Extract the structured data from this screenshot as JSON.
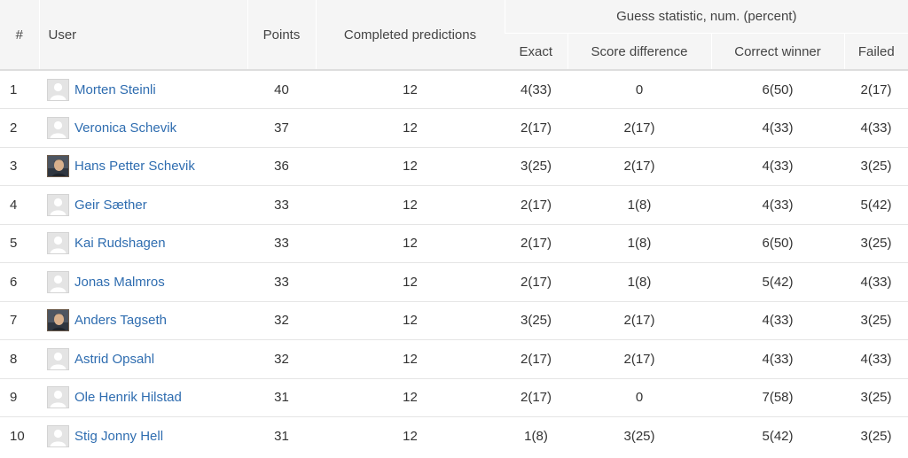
{
  "table": {
    "headers": {
      "rank": "#",
      "user": "User",
      "points": "Points",
      "completed": "Completed predictions",
      "guess_group": "Guess statistic, num. (percent)",
      "exact": "Exact",
      "score_diff": "Score difference",
      "correct_winner": "Correct winner",
      "failed": "Failed"
    },
    "rows": [
      {
        "rank": "1",
        "name": "Morten Steinli",
        "avatar": "default",
        "points": "40",
        "completed": "12",
        "exact": "4(33)",
        "score_diff": "0",
        "correct_winner": "6(50)",
        "failed": "2(17)"
      },
      {
        "rank": "2",
        "name": "Veronica Schevik",
        "avatar": "default",
        "points": "37",
        "completed": "12",
        "exact": "2(17)",
        "score_diff": "2(17)",
        "correct_winner": "4(33)",
        "failed": "4(33)"
      },
      {
        "rank": "3",
        "name": "Hans Petter Schevik",
        "avatar": "photo",
        "points": "36",
        "completed": "12",
        "exact": "3(25)",
        "score_diff": "2(17)",
        "correct_winner": "4(33)",
        "failed": "3(25)"
      },
      {
        "rank": "4",
        "name": "Geir Sæther",
        "avatar": "default",
        "points": "33",
        "completed": "12",
        "exact": "2(17)",
        "score_diff": "1(8)",
        "correct_winner": "4(33)",
        "failed": "5(42)"
      },
      {
        "rank": "5",
        "name": "Kai Rudshagen",
        "avatar": "default",
        "points": "33",
        "completed": "12",
        "exact": "2(17)",
        "score_diff": "1(8)",
        "correct_winner": "6(50)",
        "failed": "3(25)"
      },
      {
        "rank": "6",
        "name": "Jonas Malmros",
        "avatar": "default",
        "points": "33",
        "completed": "12",
        "exact": "2(17)",
        "score_diff": "1(8)",
        "correct_winner": "5(42)",
        "failed": "4(33)"
      },
      {
        "rank": "7",
        "name": "Anders Tagseth",
        "avatar": "photo",
        "points": "32",
        "completed": "12",
        "exact": "3(25)",
        "score_diff": "2(17)",
        "correct_winner": "4(33)",
        "failed": "3(25)"
      },
      {
        "rank": "8",
        "name": "Astrid Opsahl",
        "avatar": "default",
        "points": "32",
        "completed": "12",
        "exact": "2(17)",
        "score_diff": "2(17)",
        "correct_winner": "4(33)",
        "failed": "4(33)"
      },
      {
        "rank": "9",
        "name": "Ole Henrik Hilstad",
        "avatar": "default",
        "points": "31",
        "completed": "12",
        "exact": "2(17)",
        "score_diff": "0",
        "correct_winner": "7(58)",
        "failed": "3(25)"
      },
      {
        "rank": "10",
        "name": "Stig Jonny Hell",
        "avatar": "default",
        "points": "31",
        "completed": "12",
        "exact": "1(8)",
        "score_diff": "3(25)",
        "correct_winner": "5(42)",
        "failed": "3(25)"
      }
    ]
  },
  "colors": {
    "link": "#2f6db0",
    "header_bg": "#f5f5f5",
    "row_border": "#e5e5e5"
  }
}
